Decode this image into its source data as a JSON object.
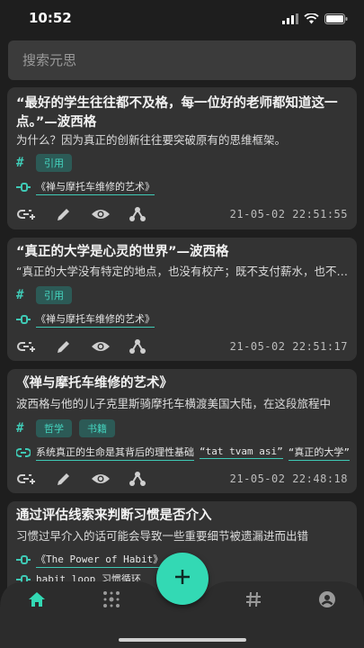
{
  "status": {
    "time": "10:52"
  },
  "search": {
    "placeholder": "搜索元思"
  },
  "cards": [
    {
      "title": "“最好的学生往往都不及格，每一位好的老师都知道这一点。”—波西格",
      "body": "为什么？因为真正的创新往往要突破原有的思维框架。",
      "tags": [
        "引用"
      ],
      "links": [
        "《禅与摩托车维修的艺术》"
      ],
      "timestamp": "21-05-02 22:51:55"
    },
    {
      "title": "“真正的大学是心灵的世界”—波西格",
      "body": "“真正的大学没有特定的地点，也没有校产；既不支付薪水，也不收取会费。",
      "tags": [
        "引用"
      ],
      "links": [
        "《禅与摩托车维修的艺术》"
      ],
      "timestamp": "21-05-02 22:51:17"
    },
    {
      "title": "《禅与摩托车维修的艺术》",
      "body": "波西格与他的儿子克里斯骑摩托车横渡美国大陆，在这段旅程中",
      "tags": [
        "哲学",
        "书籍"
      ],
      "links": [
        "系统真正的生命是其背后的理性基础",
        "“tat tvam asi”",
        "“真正的大学”"
      ],
      "timestamp": "21-05-02 22:48:18"
    },
    {
      "title": "通过评估线索来判断习惯是否介入",
      "body": "习惯过早介入的话可能会导致一些重要细节被遗漏进而出错",
      "links": [
        "《The Power of Habit》",
        "habit loop 习惯循环"
      ]
    }
  ],
  "colors": {
    "accent": "#33d9b4",
    "tag_bg": "#2c5a56",
    "card_bg": "#333333",
    "bg": "#1e1e1e"
  },
  "nav": {
    "items": [
      "home-icon",
      "graph-icon",
      "tag-hash-icon",
      "profile-icon"
    ],
    "active": "home-icon",
    "fab_icon": "plus-icon"
  }
}
